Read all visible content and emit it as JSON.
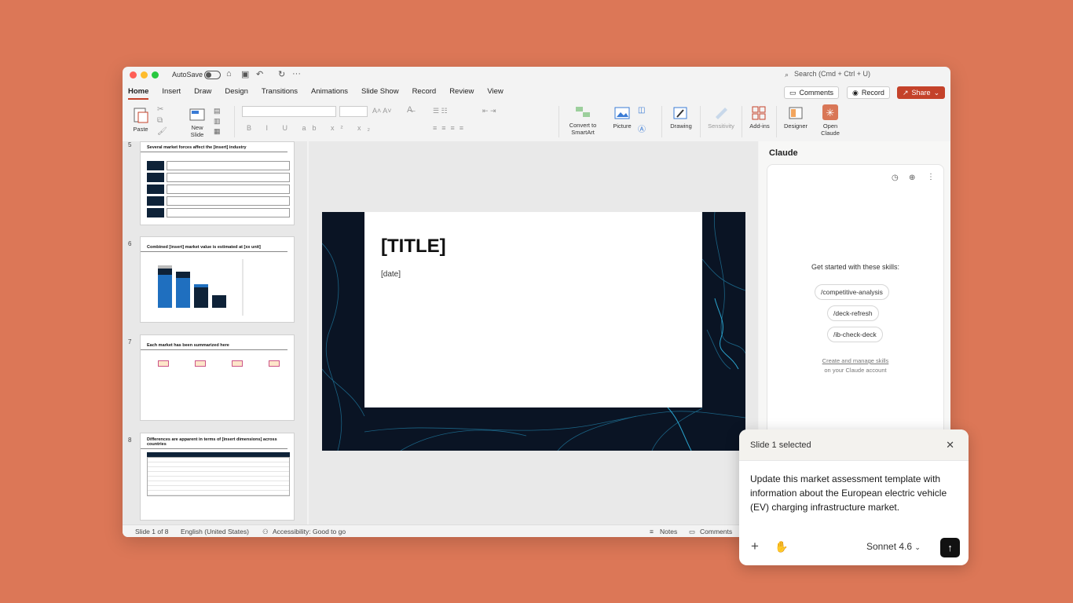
{
  "titlebar": {
    "autosave": "AutoSave",
    "search_placeholder": "Search (Cmd + Ctrl + U)"
  },
  "tabs": [
    "Home",
    "Insert",
    "Draw",
    "Design",
    "Transitions",
    "Animations",
    "Slide Show",
    "Record",
    "Review",
    "View"
  ],
  "top_buttons": {
    "comments": "Comments",
    "record": "Record",
    "share": "Share"
  },
  "ribbon": {
    "paste": "Paste",
    "new_slide": "New Slide",
    "convert_smartart": "Convert to SmartArt",
    "picture": "Picture",
    "drawing": "Drawing",
    "sensitivity": "Sensitivity",
    "addins": "Add-ins",
    "designer": "Designer",
    "open_claude": "Open Claude"
  },
  "thumbnails": [
    {
      "num": "5",
      "title": "Several market forces affect the [insert] industry"
    },
    {
      "num": "6",
      "title": "Combined [insert] market value is estimated at [xx unit]"
    },
    {
      "num": "7",
      "title": "Each market has been summarized here"
    },
    {
      "num": "8",
      "title": "Differences are apparent in terms of [insert dimensions] across countries"
    }
  ],
  "slide": {
    "title": "[TITLE]",
    "date": "[date]"
  },
  "claude_pane": {
    "title": "Claude",
    "skills_header": "Get started with these skills:",
    "skills": [
      "/competitive-analysis",
      "/deck-refresh",
      "/ib-check-deck"
    ],
    "manage_link": "Create and manage skills",
    "manage_sub": "on your Claude account"
  },
  "statusbar": {
    "slide_count": "Slide 1 of 8",
    "language": "English (United States)",
    "accessibility": "Accessibility: Good to go",
    "notes": "Notes",
    "comments": "Comments"
  },
  "popup": {
    "header": "Slide 1 selected",
    "prompt": "Update this market assessment template with information about the European electric vehicle (EV) charging infrastructure market.",
    "model": "Sonnet 4.6"
  },
  "colors": {
    "background": "#DC7757",
    "accent": "#C4422A",
    "slide_bg": "#0a1424"
  }
}
